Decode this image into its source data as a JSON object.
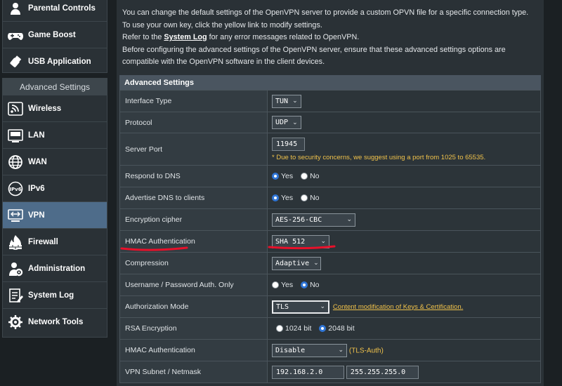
{
  "sidebar": {
    "top_items": [
      {
        "label": "Parental Controls",
        "icon": "parental-icon"
      },
      {
        "label": "Game Boost",
        "icon": "gamepad-icon"
      },
      {
        "label": "USB Application",
        "icon": "usb-icon"
      }
    ],
    "advanced_header": "Advanced Settings",
    "advanced_items": [
      {
        "label": "Wireless",
        "icon": "wireless-icon"
      },
      {
        "label": "LAN",
        "icon": "lan-icon"
      },
      {
        "label": "WAN",
        "icon": "wan-icon"
      },
      {
        "label": "IPv6",
        "icon": "ipv6-icon"
      },
      {
        "label": "VPN",
        "icon": "vpn-icon",
        "active": true
      },
      {
        "label": "Firewall",
        "icon": "firewall-icon"
      },
      {
        "label": "Administration",
        "icon": "administration-icon"
      },
      {
        "label": "System Log",
        "icon": "system-log-icon"
      },
      {
        "label": "Network Tools",
        "icon": "network-tools-icon"
      }
    ]
  },
  "info": {
    "line1": "You can change the default settings of the OpenVPN server to provide a custom OPVN file for a specific connection type.",
    "line2": "To use your own key, click the yellow link to modify settings.",
    "line3_pre": "Refer to the ",
    "line3_link": "System Log",
    "line3_post": " for any error messages related to OpenVPN.",
    "line4": "Before configuring the advanced settings of the OpenVPN server, ensure that these advanced settings options are compatible with the OpenVPN software in the client devices."
  },
  "section_title": "Advanced Settings",
  "settings": {
    "interface_type": {
      "label": "Interface Type",
      "value": "TUN"
    },
    "protocol": {
      "label": "Protocol",
      "value": "UDP"
    },
    "server_port": {
      "label": "Server Port",
      "value": "11945",
      "hint": "* Due to security concerns, we suggest using a port from 1025 to 65535."
    },
    "respond_dns": {
      "label": "Respond to DNS",
      "yes": "Yes",
      "no": "No",
      "selected": "Yes"
    },
    "advertise_dns": {
      "label": "Advertise DNS to clients",
      "yes": "Yes",
      "no": "No",
      "selected": "Yes"
    },
    "encryption_cipher": {
      "label": "Encryption cipher",
      "value": "AES-256-CBC"
    },
    "hmac_auth": {
      "label": "HMAC Authentication",
      "value": "SHA 512"
    },
    "compression": {
      "label": "Compression",
      "value": "Adaptive"
    },
    "userpass_only": {
      "label": "Username / Password Auth. Only",
      "yes": "Yes",
      "no": "No",
      "selected": "No"
    },
    "auth_mode": {
      "label": "Authorization Mode",
      "value": "TLS",
      "link": "Content modification of Keys & Certification."
    },
    "rsa_encryption": {
      "label": "RSA Encryption",
      "opt1": "1024 bit",
      "opt2": "2048 bit",
      "selected": "2048 bit"
    },
    "hmac_auth2": {
      "label": "HMAC Authentication",
      "value": "Disable",
      "note": "(TLS-Auth)"
    },
    "vpn_subnet": {
      "label": "VPN Subnet / Netmask",
      "subnet": "192.168.2.0",
      "netmask": "255.255.255.0"
    }
  },
  "colors": {
    "active_nav": "#4e6c8a",
    "hint": "#f0c24b",
    "annotation": "#e8102a"
  }
}
